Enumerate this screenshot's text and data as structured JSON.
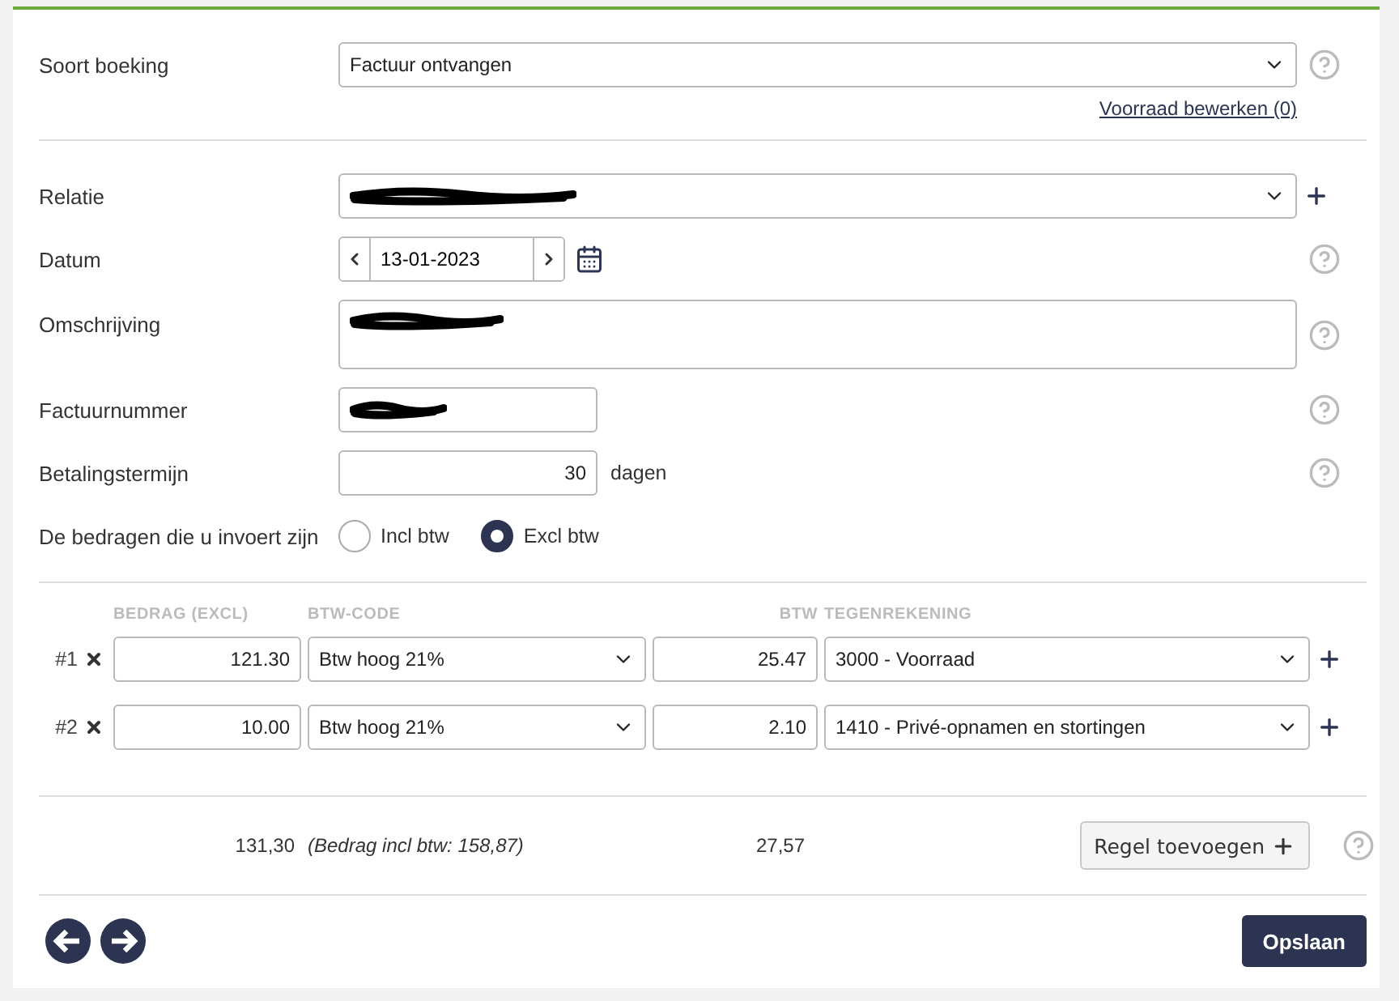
{
  "booking_type": {
    "label": "Soort boeking",
    "value": "Factuur ontvangen",
    "link": "Voorraad bewerken (0)",
    "help": true
  },
  "fields": [
    {
      "kind": "select",
      "label": "Relatie",
      "redacted": true,
      "add": true,
      "help": false
    },
    {
      "kind": "date",
      "label": "Datum",
      "value": "13-01-2023",
      "help": true
    },
    {
      "kind": "textarea",
      "label": "Omschrijving",
      "redacted": true,
      "help": true
    },
    {
      "kind": "text",
      "label": "Factuurnummer",
      "redacted": true,
      "help": true
    },
    {
      "kind": "number",
      "label": "Betalingstermijn",
      "value": "30",
      "unit": "dagen",
      "help": true
    }
  ],
  "amounts": {
    "label": "De bedragen die u invoert zijn",
    "options": [
      {
        "label": "Incl btw",
        "selected": false
      },
      {
        "label": "Excl btw",
        "selected": true
      }
    ]
  },
  "lines": {
    "headers": [
      "BEDRAG (EXCL)",
      "BTW-CODE",
      "BTW",
      "TEGENREKENING"
    ],
    "rows": [
      {
        "number": "#1",
        "amount": "121.30",
        "code": "Btw hoog 21%",
        "vat": "25.47",
        "account": "3000 - Voorraad"
      },
      {
        "number": "#2",
        "amount": "10.00",
        "code": "Btw hoog 21%",
        "vat": "2.10",
        "account": "1410 - Privé-opnamen en stortingen"
      }
    ]
  },
  "totals": {
    "amount": "131,30",
    "incl": "(Bedrag incl btw: 158,87)",
    "vat": "27,57",
    "add_button": "Regel toevoegen",
    "help": true
  },
  "save_button": "Opslaan"
}
